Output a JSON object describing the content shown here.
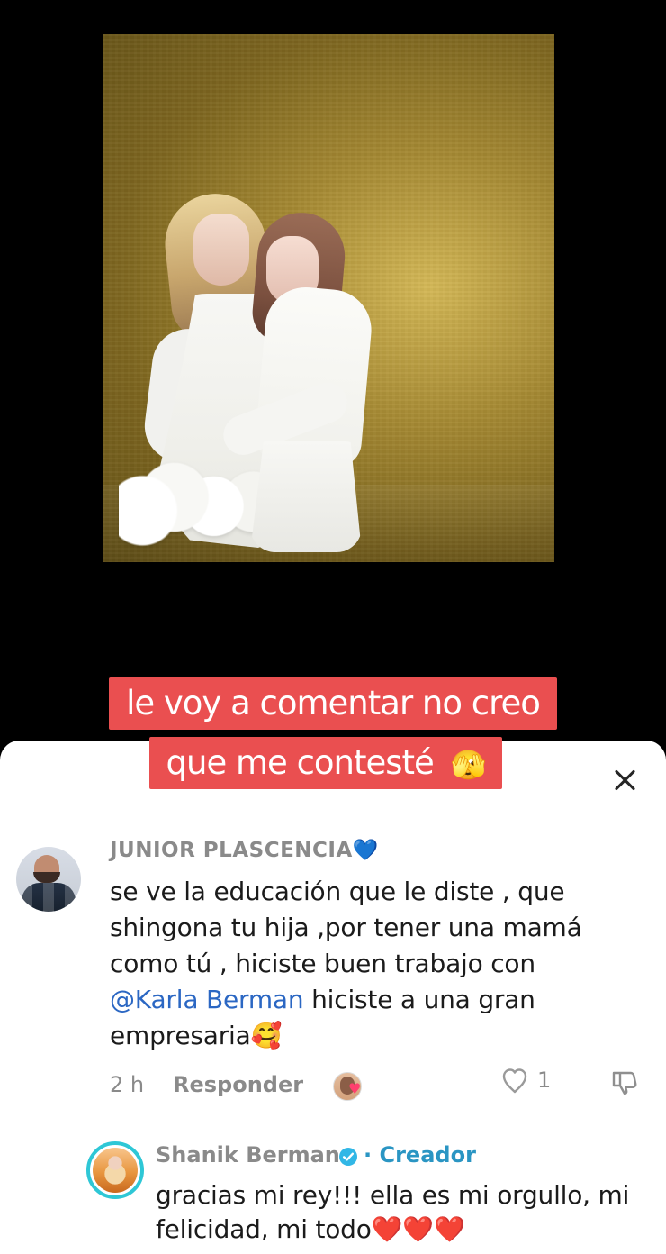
{
  "caption": {
    "line1": "le voy a comentar no creo",
    "line2": "que me contesté",
    "emoji": "🫣"
  },
  "comment": {
    "author": "JUNIOR PLASCENCIA💙",
    "text_part1": "se ve la educación que le diste , que shingona tu hija ,por tener una mamá como tú , hiciste buen trabajo con ",
    "mention": "@Karla Berman",
    "text_part2": " hiciste a una gran empresaria🥰",
    "time": "2 h",
    "reply_label": "Responder",
    "likes": "1"
  },
  "reply": {
    "author": "Shanik Berman",
    "badge": "· Creador",
    "text": "gracias mi rey!!! ella es mi orgullo, mi felicidad, mi todo❤️❤️❤️"
  },
  "colors": {
    "caption_bg": "#ea4f50",
    "mention": "#2b67c3",
    "creator": "#2a95c3",
    "verified": "#31b7e6"
  },
  "icons": {
    "close": "close-icon",
    "like": "heart-outline-icon",
    "dislike": "thumbs-down-icon",
    "verified": "verified-badge-icon"
  }
}
